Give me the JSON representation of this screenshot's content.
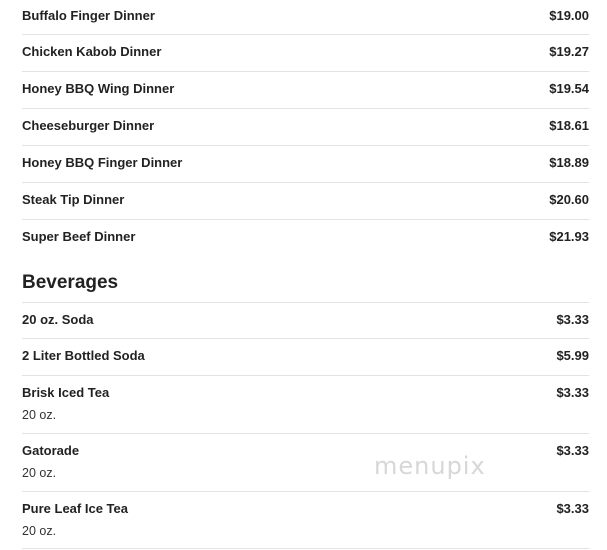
{
  "dinners": [
    {
      "name": "Buffalo Finger Dinner",
      "price": "$19.00"
    },
    {
      "name": "Chicken Kabob Dinner",
      "price": "$19.27"
    },
    {
      "name": "Honey BBQ Wing Dinner",
      "price": "$19.54"
    },
    {
      "name": "Cheeseburger Dinner",
      "price": "$18.61"
    },
    {
      "name": "Honey BBQ Finger Dinner",
      "price": "$18.89"
    },
    {
      "name": "Steak Tip Dinner",
      "price": "$20.60"
    },
    {
      "name": "Super Beef Dinner",
      "price": "$21.93"
    }
  ],
  "beverages": {
    "title": "Beverages",
    "items": [
      {
        "name": "20 oz. Soda",
        "price": "$3.33",
        "desc": ""
      },
      {
        "name": "2 Liter Bottled Soda",
        "price": "$5.99",
        "desc": ""
      },
      {
        "name": "Brisk Iced Tea",
        "price": "$3.33",
        "desc": "20 oz."
      },
      {
        "name": "Gatorade",
        "price": "$3.33",
        "desc": "20 oz."
      },
      {
        "name": "Pure Leaf Ice Tea",
        "price": "$3.33",
        "desc": "20 oz."
      }
    ]
  },
  "watermark": "menupix"
}
